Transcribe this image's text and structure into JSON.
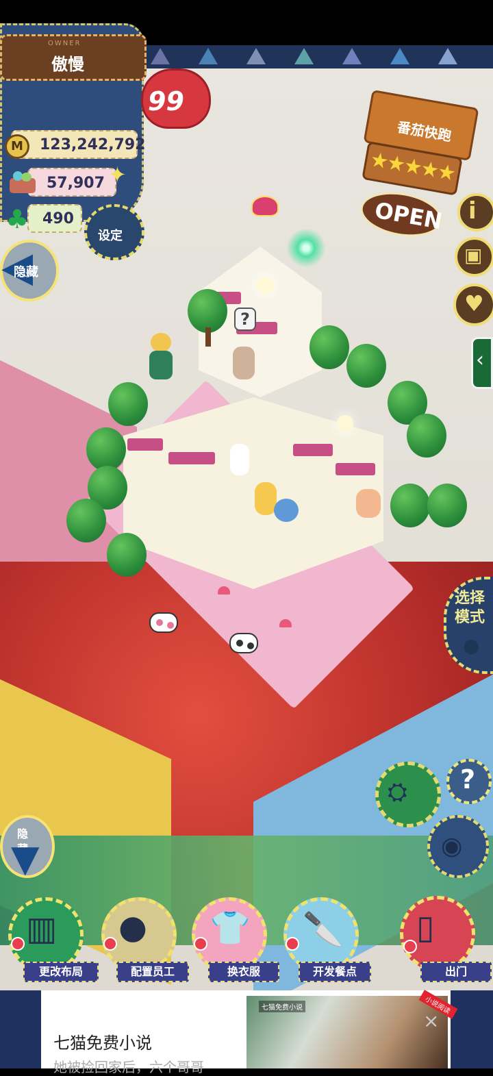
{
  "owner": {
    "label": "OWNER",
    "name": "傲慢",
    "level": "99",
    "coins": "123,242,792",
    "materials": "57,907",
    "clovers": "490",
    "coin_icon": "M"
  },
  "buttons": {
    "settings": "设定",
    "hide": "隐藏",
    "select_mode": "选择模式"
  },
  "restaurant": {
    "name": "番茄快跑",
    "rating_stars": "★★★★★",
    "status": "OPEN"
  },
  "bottom_toolbar": [
    {
      "label": "更改布局",
      "icon": "table-icon"
    },
    {
      "label": "配置员工",
      "icon": "mouse-head-icon"
    },
    {
      "label": "换衣服",
      "icon": "shirt-icon"
    },
    {
      "label": "开发餐点",
      "icon": "knife-icon"
    },
    {
      "label": "出门",
      "icon": "door-icon"
    }
  ],
  "ad": {
    "title": "七猫免费小说",
    "subtitle": "她被捡回家后，六个哥哥",
    "image_caption": "七猫免费小说",
    "badge": "小说阅读"
  },
  "colors": {
    "panel_navy": "#2f4d7c",
    "stitch_yellow": "#e4d96d",
    "heart_red": "#d73840",
    "pin_red": "#e83e4d"
  }
}
